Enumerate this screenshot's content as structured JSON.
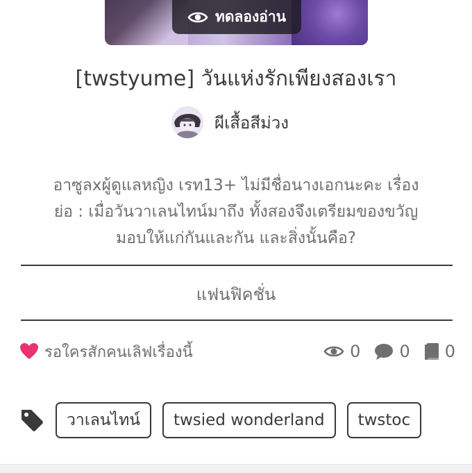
{
  "cover": {
    "trial_label": "ทดลองอ่าน",
    "trial_icon": "eye-icon"
  },
  "story": {
    "title": "[twstyume] วันแห่งรักเพียงสองเรา",
    "author": "ผีเสื้อสีม่วง",
    "description_lines": [
      "อาซูลxผู้ดูแลหญิง เรท13+ ไม่มีชื่อนางเอกนะคะ เรื่อง",
      "ย่อ : เมื่อวันวาเลนไทน์มาถึง ทั้งสองจึงเตรียมของขวัญ",
      "มอบให้แก่กันและกัน และสิ่งนั้นคือ?"
    ],
    "category": "แฟนฟิคชั่น"
  },
  "stats": {
    "like_text": "รอใครสักคนเลิฟเรื่องนี้",
    "views": "0",
    "comments": "0",
    "chapters": "0",
    "heart_color": "#e8336c"
  },
  "tags": {
    "items": [
      "วาเลนไทน์",
      "twsied wonderland",
      "twstoc"
    ]
  }
}
